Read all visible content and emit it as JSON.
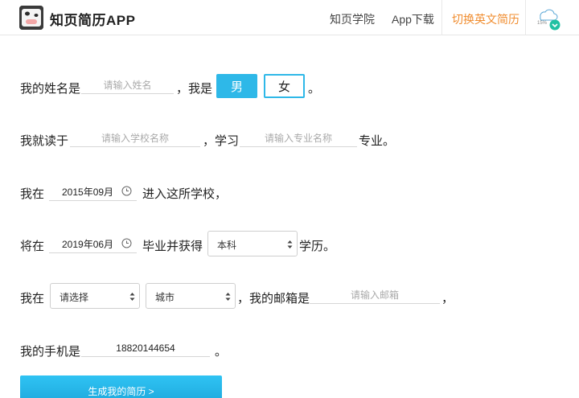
{
  "header": {
    "app_title": "知页简历APP",
    "logo_text": "知页",
    "nav": [
      {
        "label": "知页学院"
      },
      {
        "label": "App下载"
      },
      {
        "label": "切换英文简历"
      }
    ],
    "user_badge": "15%"
  },
  "form": {
    "name_prefix": "我的姓名是",
    "name_placeholder": "请输入姓名",
    "gender_prefix": "，我是",
    "gender_male": "男",
    "gender_female": "女",
    "gender_selected": "男",
    "gender_suffix": "。",
    "school_prefix": "我就读于",
    "school_placeholder": "请输入学校名称",
    "major_prefix": "，学习",
    "major_placeholder": "请输入专业名称",
    "major_suffix": "专业。",
    "enroll_prefix": "我在",
    "enroll_date": "2015年09月",
    "enroll_suffix": "进入这所学校，",
    "grad_prefix": "将在",
    "grad_date": "2019年06月",
    "grad_middle": "毕业并获得",
    "degree_value": "本科",
    "grad_suffix": "学历。",
    "location_prefix": "我在",
    "province_value": "请选择",
    "city_value": "城市",
    "email_prefix": "，我的邮箱是",
    "email_placeholder": "请输入邮箱",
    "email_suffix": "，",
    "phone_prefix": "我的手机是",
    "phone_value": "18820144654",
    "phone_suffix": "。",
    "submit_label": "生成我的简历 >"
  },
  "colors": {
    "accent": "#2eb8e8",
    "nav_highlight": "#f08c2e"
  }
}
